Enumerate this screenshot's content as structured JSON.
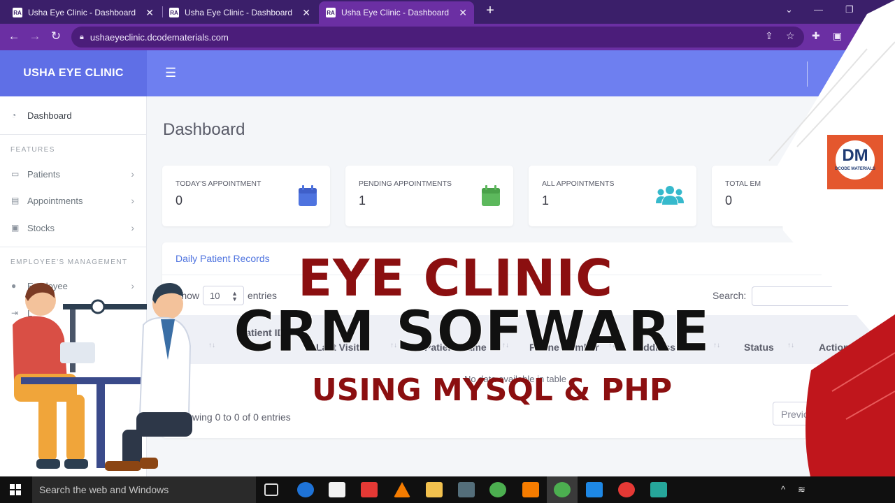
{
  "browser": {
    "tabs": [
      {
        "title": "Usha Eye Clinic - Dashboard",
        "favicon": "RA",
        "active": false
      },
      {
        "title": "Usha Eye Clinic - Dashboard",
        "favicon": "RA",
        "active": false
      },
      {
        "title": "Usha Eye Clinic - Dashboard",
        "favicon": "RA",
        "active": true
      }
    ],
    "url": "ushaeyeclinic.dcodematerials.com"
  },
  "app": {
    "brand": "USHA EYE CLINIC",
    "page_title": "Dashboard"
  },
  "sidebar": {
    "dashboard": "Dashboard",
    "features_heading": "FEATURES",
    "patients": "Patients",
    "appointments": "Appointments",
    "stocks": "Stocks",
    "employee_heading": "EMPLOYEE'S MANAGEMENT",
    "employee": "Employee",
    "logout": "L"
  },
  "cards": [
    {
      "label": "TODAY'S APPOINTMENT",
      "value": "0",
      "icon": "calendar-icon",
      "color": "#4e73df"
    },
    {
      "label": "PENDING APPOINTMENTS",
      "value": "1",
      "icon": "calendar-icon",
      "color": "#1cc88a"
    },
    {
      "label": "ALL APPOINTMENTS",
      "value": "1",
      "icon": "users-icon",
      "color": "#36b9cc"
    },
    {
      "label": "TOTAL EM",
      "value": "0",
      "icon": "",
      "color": ""
    }
  ],
  "records": {
    "title": "Daily Patient Records",
    "show_label": "Show",
    "page_size": "10",
    "entries_label": "entries",
    "search_label": "Search:",
    "columns": [
      "Patient ID",
      "Last Visit",
      "Patient Name",
      "Phone Number",
      "Address",
      "Status",
      "Action"
    ],
    "empty_text": "No data available in table",
    "info": "Showing 0 to 0 of 0 entries",
    "prev_label": "Previous"
  },
  "thumbnail": {
    "line1": "EYE CLINIC",
    "line2": "CRM SOFWARE",
    "line3": "USING MYSQL & PHP",
    "logo_text": "DM",
    "logo_subtext": "DCODE MATERIALS"
  },
  "taskbar": {
    "search_placeholder": "Search the web and Windows"
  }
}
